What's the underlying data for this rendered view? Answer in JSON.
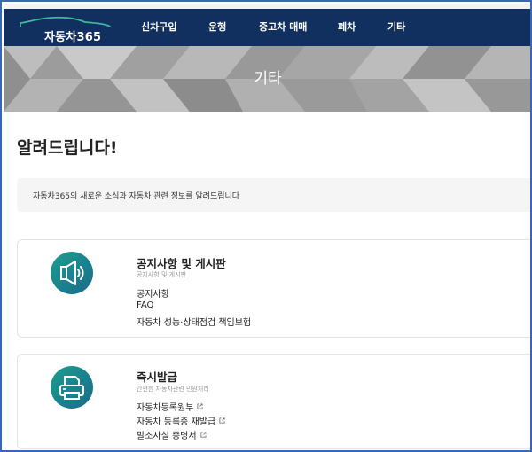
{
  "header": {
    "logo_text": "자동차365",
    "menu": [
      {
        "label": "신차구입"
      },
      {
        "label": "운행"
      },
      {
        "label": "중고차 매매"
      },
      {
        "label": "폐차"
      },
      {
        "label": "기타"
      }
    ]
  },
  "hero": {
    "title": "기타"
  },
  "main": {
    "page_title": "알려드립니다!",
    "notice": "자동차365의 새로운 소식과 자동차 관련 정보를 알려드립니다",
    "cards": [
      {
        "title": "공지사항 및 게시판",
        "subtitle": "공지사항 및 게시판",
        "icon": "speaker-icon",
        "links": [
          {
            "label": "공지사항",
            "external": false
          },
          {
            "label": "FAQ",
            "external": false
          },
          {
            "label": "자동차 성능·상태점검 책임보험",
            "external": false
          }
        ]
      },
      {
        "title": "즉시발급",
        "subtitle": "간편한 자동차관련 민원처리",
        "icon": "printer-icon",
        "links": [
          {
            "label": "자동차등록원부",
            "external": true
          },
          {
            "label": "자동차 등록증 재발급",
            "external": true
          },
          {
            "label": "말소사실 증명서",
            "external": true
          }
        ]
      }
    ]
  },
  "colors": {
    "nav_bg": "#11305f",
    "accent_teal": "#1d9e8c",
    "frame_border": "#3a66b8"
  }
}
